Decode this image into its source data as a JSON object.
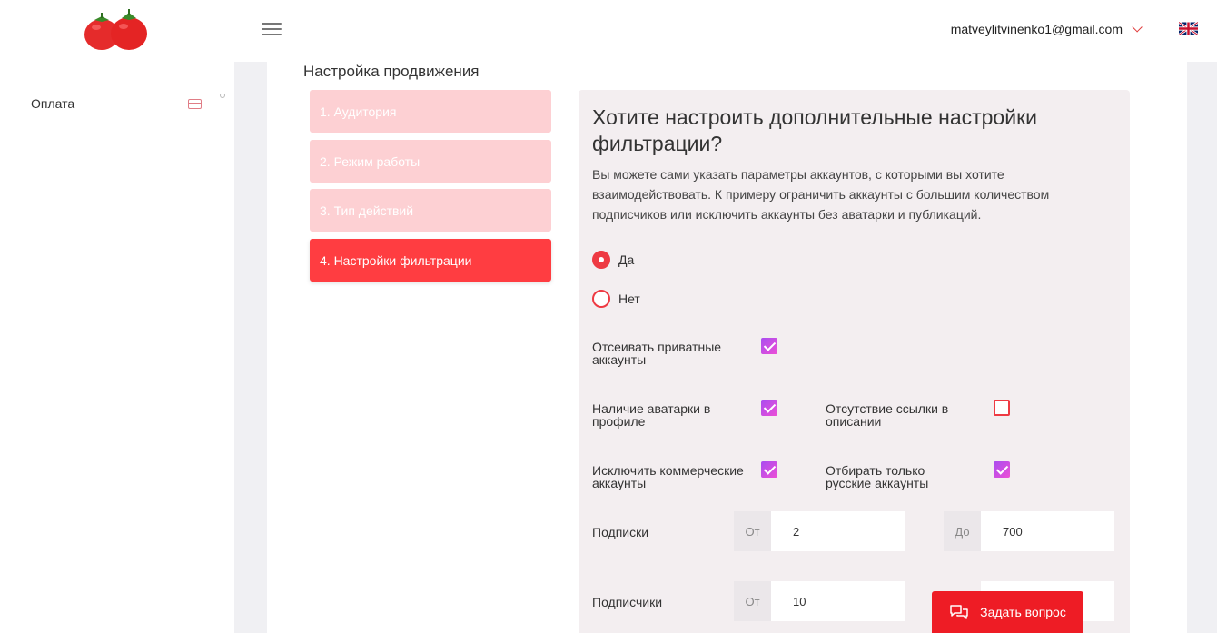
{
  "header": {
    "user_email": "matveylitvinenko1@gmail.com",
    "language_flag": "uk-flag-icon"
  },
  "sidebar": {
    "items": [
      {
        "label": "Оплата",
        "icon": "credit-card-icon"
      }
    ]
  },
  "page": {
    "title": "Настройка продвижения"
  },
  "steps": [
    {
      "label": "1. Аудитория",
      "state": "inactive"
    },
    {
      "label": "2. Режим работы",
      "state": "inactive"
    },
    {
      "label": "3. Тип действий",
      "state": "inactive"
    },
    {
      "label": "4. Настройки фильтрации",
      "state": "active"
    }
  ],
  "filter": {
    "question": "Хотите настроить дополнительные настройки фильтрации?",
    "description": "Вы можете сами указать параметры аккаунтов, с которыми вы хотите взаимодействовать. К примеру ограничить аккаунты с большим количеством подписчиков или исключить аккаунты без аватарки и публикаций.",
    "radio_yes": "Да",
    "radio_no": "Нет",
    "selected": "yes",
    "options": {
      "private": {
        "label": "Отсеивать приватные аккаунты",
        "checked": true
      },
      "avatar": {
        "label": "Наличие аватарки в профиле",
        "checked": true
      },
      "no_link": {
        "label": "Отсутствие ссылки в описании",
        "checked": false
      },
      "commercial": {
        "label": "Исключить коммерческие аккаунты",
        "checked": true
      },
      "russian": {
        "label": "Отбирать только русские аккаунты",
        "checked": true
      }
    },
    "following": {
      "label": "Подписки",
      "from_label": "От",
      "from_value": "2",
      "to_label": "До",
      "to_value": "700"
    },
    "followers": {
      "label": "Подписчики",
      "from_label": "От",
      "from_value": "10"
    }
  },
  "chat": {
    "label": "Задать вопрос"
  },
  "colors": {
    "accent": "#ee1c25",
    "step_active": "#ff3d41",
    "step_inactive": "#fdd0d3",
    "checkbox": "#b44ff0"
  }
}
